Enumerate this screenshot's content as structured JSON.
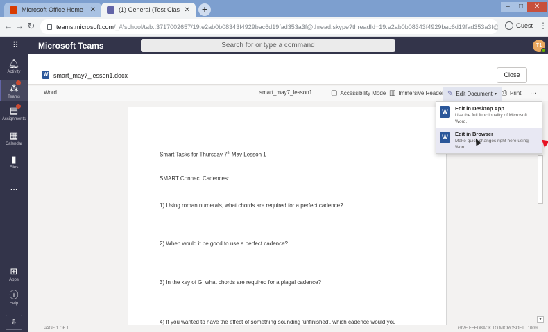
{
  "browser": {
    "tabs": [
      {
        "title": "Microsoft Office Home",
        "favicon_color": "#d83b01"
      },
      {
        "title": "(1) General (Test Class - C.Turnp",
        "favicon_color": "#6264a7"
      }
    ],
    "new_tab_glyph": "+",
    "address": {
      "host": "teams.microsoft.com",
      "path": "/_#/school/tab::3717002657/19:e2ab0b08343f4929bac6d19fad353a3f@thread.skype?threadId=19:e2ab0b08343f4929bac6d19fad353a3f@thread.skype&..."
    },
    "profile_label": "Guest"
  },
  "teams": {
    "app_title": "Microsoft Teams",
    "search_placeholder": "Search for or type a command",
    "avatar_initials": "T1",
    "rail": [
      {
        "label": "Activity",
        "icon": "bell-icon"
      },
      {
        "label": "Teams",
        "icon": "teams-icon"
      },
      {
        "label": "Assignments",
        "icon": "assignments-icon"
      },
      {
        "label": "Calendar",
        "icon": "calendar-icon"
      },
      {
        "label": "Files",
        "icon": "files-icon"
      },
      {
        "label": "...",
        "icon": "more-icon"
      },
      {
        "label": "Apps",
        "icon": "apps-icon"
      },
      {
        "label": "Help",
        "icon": "help-icon"
      }
    ]
  },
  "file": {
    "name": "smart_may7_lesson1.docx",
    "close_label": "Close"
  },
  "ribbon": {
    "app_label": "Word",
    "doc_name": "smart_may7_lesson1",
    "accessibility_label": "Accessibility Mode",
    "immersive_label": "Immersive Reader",
    "edit_label": "Edit Document",
    "print_label": "Print",
    "more_label": "..."
  },
  "document": {
    "title_pre": "Smart Tasks for Thursday 7",
    "title_sup": "th",
    "title_post": " May Lesson 1",
    "section": "SMART Connect Cadences:",
    "questions": [
      "1)  Using roman numerals, what chords are required for a perfect cadence?",
      "2)  When would it be good to use a perfect cadence?",
      "3)  In the key of G, what chords are required for a plagal cadence?",
      "4)  If you wanted to have the effect of something sounding 'unfinished', which cadence would you"
    ]
  },
  "dropdown": {
    "items": [
      {
        "title": "Edit in Desktop App",
        "desc": "Use the full functionality of Microsoft Word."
      },
      {
        "title": "Edit in Browser",
        "desc": "Make quick changes right here using Word."
      }
    ]
  },
  "status": {
    "page_label": "PAGE 1 OF 1",
    "feedback_label": "GIVE FEEDBACK TO MICROSOFT",
    "zoom_label": "100%"
  },
  "colors": {
    "teams_header": "#33344a",
    "word_blue": "#2b579a",
    "teams_accent": "#6264a7"
  }
}
